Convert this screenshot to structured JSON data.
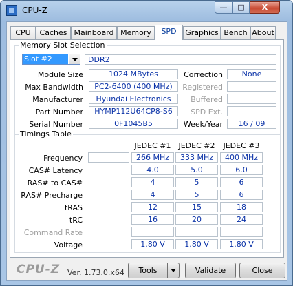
{
  "window": {
    "title": "CPU-Z",
    "icon": "cpu-z-app-icon",
    "controls": {
      "minimize": "—",
      "maximize": "□",
      "close": "X"
    }
  },
  "tabs": [
    {
      "label": "CPU"
    },
    {
      "label": "Caches"
    },
    {
      "label": "Mainboard"
    },
    {
      "label": "Memory"
    },
    {
      "label": "SPD",
      "active": true
    },
    {
      "label": "Graphics"
    },
    {
      "label": "Bench"
    },
    {
      "label": "About"
    }
  ],
  "slot_selection": {
    "legend": "Memory Slot Selection",
    "slot": "Slot #2",
    "type": "DDR2",
    "fields": {
      "module_size": {
        "label": "Module Size",
        "value": "1024 MBytes"
      },
      "max_bandwidth": {
        "label": "Max Bandwidth",
        "value": "PC2-6400 (400 MHz)"
      },
      "manufacturer": {
        "label": "Manufacturer",
        "value": "Hyundai Electronics"
      },
      "part_number": {
        "label": "Part Number",
        "value": "HYMP112U64CP8-S6"
      },
      "serial_number": {
        "label": "Serial Number",
        "value": "0F1045B5"
      },
      "correction": {
        "label": "Correction",
        "value": "None"
      },
      "registered": {
        "label": "Registered",
        "value": ""
      },
      "buffered": {
        "label": "Buffered",
        "value": ""
      },
      "spd_ext": {
        "label": "SPD Ext.",
        "value": ""
      },
      "week_year": {
        "label": "Week/Year",
        "value": "16 / 09"
      }
    }
  },
  "timings": {
    "legend": "Timings Table",
    "columns": [
      "JEDEC #1",
      "JEDEC #2",
      "JEDEC #3"
    ],
    "rows": [
      {
        "label": "Frequency",
        "values": [
          "266 MHz",
          "333 MHz",
          "400 MHz"
        ]
      },
      {
        "label": "CAS# Latency",
        "values": [
          "4.0",
          "5.0",
          "6.0"
        ]
      },
      {
        "label": "RAS# to CAS#",
        "values": [
          "4",
          "5",
          "6"
        ]
      },
      {
        "label": "RAS# Precharge",
        "values": [
          "4",
          "5",
          "6"
        ]
      },
      {
        "label": "tRAS",
        "values": [
          "12",
          "15",
          "18"
        ]
      },
      {
        "label": "tRC",
        "values": [
          "16",
          "20",
          "24"
        ]
      },
      {
        "label": "Command Rate",
        "values": [
          "",
          "",
          ""
        ]
      },
      {
        "label": "Voltage",
        "values": [
          "1.80 V",
          "1.80 V",
          "1.80 V"
        ]
      }
    ]
  },
  "footer": {
    "brand": "CPU-Z",
    "version": "Ver. 1.73.0.x64",
    "tools": "Tools",
    "validate": "Validate",
    "close": "Close"
  },
  "colors": {
    "value_text": "#0b33a8",
    "selection": "#3399ff",
    "close_button": "#c94b34"
  }
}
